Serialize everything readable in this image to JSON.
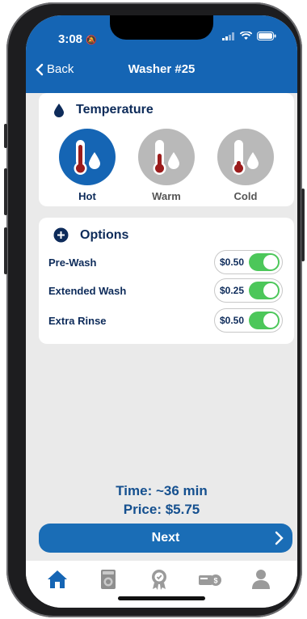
{
  "status_bar": {
    "time": "3:08"
  },
  "nav": {
    "back_label": "Back",
    "title": "Washer #25"
  },
  "temperature": {
    "heading": "Temperature",
    "options": [
      {
        "label": "Hot",
        "selected": true
      },
      {
        "label": "Warm",
        "selected": false
      },
      {
        "label": "Cold",
        "selected": false
      }
    ]
  },
  "options": {
    "heading": "Options",
    "items": [
      {
        "label": "Pre-Wash",
        "price": "$0.50",
        "enabled": true
      },
      {
        "label": "Extended Wash",
        "price": "$0.25",
        "enabled": true
      },
      {
        "label": "Extra Rinse",
        "price": "$0.50",
        "enabled": true
      }
    ]
  },
  "summary": {
    "time": "Time: ~36 min",
    "price": "Price: $5.75"
  },
  "next_label": "Next",
  "tabs": [
    "home-icon",
    "washer-icon",
    "rewards-icon",
    "payment-icon",
    "profile-icon"
  ],
  "colors": {
    "brand": "#1565b4",
    "toggle_on": "#4cc75a",
    "text_dark": "#0d2b5a",
    "thermo_red": "#9b1c1c"
  }
}
